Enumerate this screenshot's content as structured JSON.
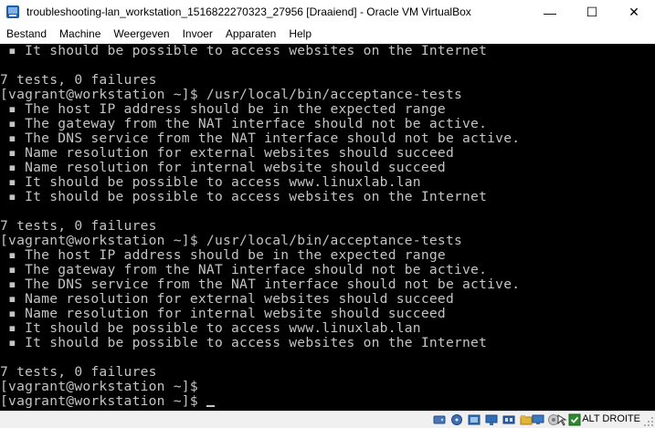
{
  "window": {
    "title": "troubleshooting-lan_workstation_1516822270323_27956 [Draaiend] - Oracle VM VirtualBox",
    "minimize_glyph": "—",
    "maximize_glyph": "☐",
    "close_glyph": "✕"
  },
  "menu": [
    {
      "label": "Bestand"
    },
    {
      "label": "Machine"
    },
    {
      "label": "Weergeven"
    },
    {
      "label": "Invoer"
    },
    {
      "label": "Apparaten"
    },
    {
      "label": "Help"
    }
  ],
  "console": {
    "lines": [
      " ▪ It should be possible to access websites on the Internet",
      "",
      "7 tests, 0 failures",
      "[vagrant@workstation ~]$ /usr/local/bin/acceptance-tests",
      " ▪ The host IP address should be in the expected range",
      " ▪ The gateway from the NAT interface should not be active.",
      " ▪ The DNS service from the NAT interface should not be active.",
      " ▪ Name resolution for external websites should succeed",
      " ▪ Name resolution for internal website should succeed",
      " ▪ It should be possible to access www.linuxlab.lan",
      " ▪ It should be possible to access websites on the Internet",
      "",
      "7 tests, 0 failures",
      "[vagrant@workstation ~]$ /usr/local/bin/acceptance-tests",
      " ▪ The host IP address should be in the expected range",
      " ▪ The gateway from the NAT interface should not be active.",
      " ▪ The DNS service from the NAT interface should not be active.",
      " ▪ Name resolution for external websites should succeed",
      " ▪ Name resolution for internal website should succeed",
      " ▪ It should be possible to access www.linuxlab.lan",
      " ▪ It should be possible to access websites on the Internet",
      "",
      "7 tests, 0 failures",
      "[vagrant@workstation ~]$",
      "[vagrant@workstation ~]$ "
    ]
  },
  "statusbar": {
    "host_key": "ALT DROITE",
    "icons": [
      "hard-disk-icon",
      "optical-drive-icon",
      "audio-icon",
      "network-icon",
      "usb-icon",
      "shared-folders-icon",
      "display-icon",
      "video-capture-icon",
      "mouse-integration-icon",
      "keyboard-capture-icon"
    ]
  },
  "colors": {
    "console_bg": "#000000",
    "console_fg": "#c4c4c4",
    "statusbar_bg": "#f0f0f0"
  }
}
